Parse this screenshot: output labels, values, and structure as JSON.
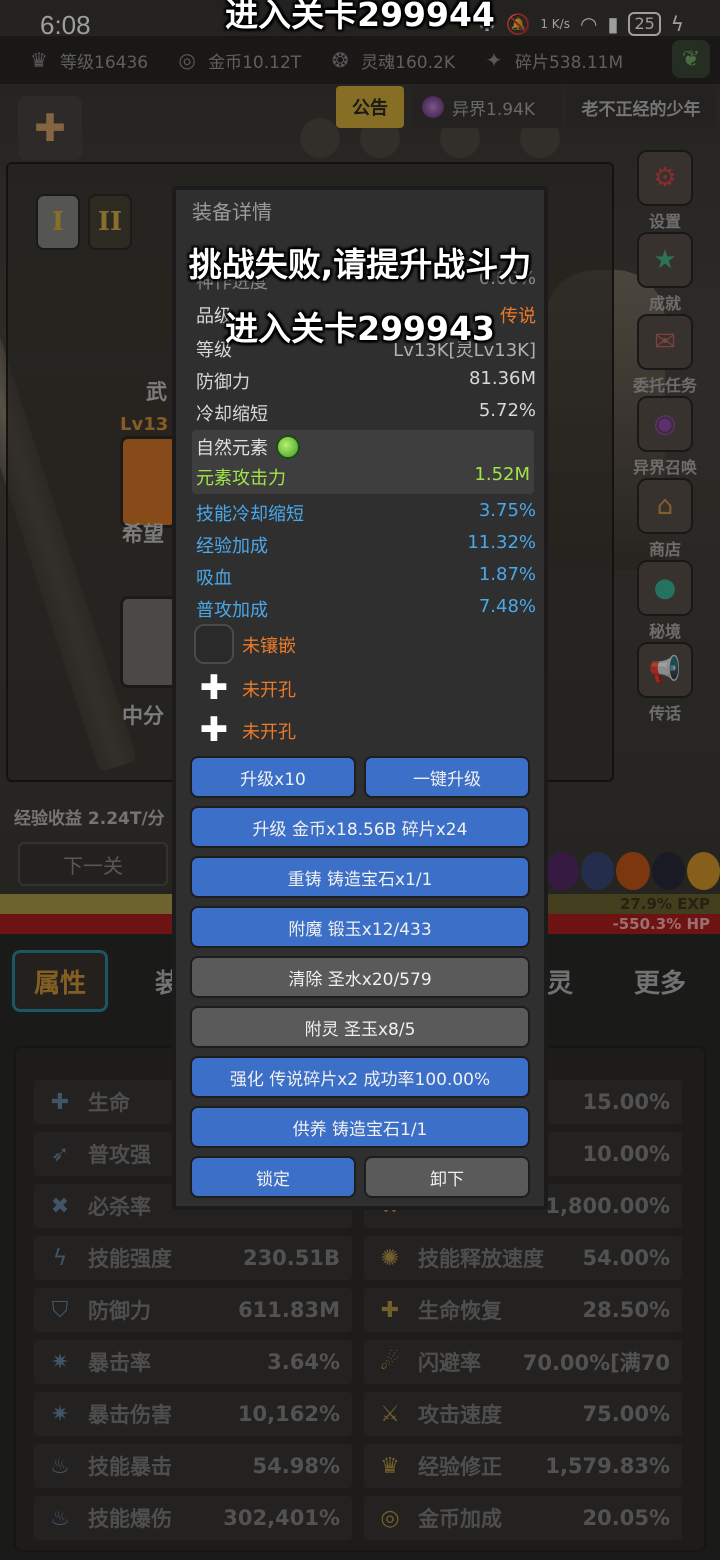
{
  "status_bar": {
    "time": "6:08",
    "speed": "1 K/s",
    "battery": "25"
  },
  "resources": {
    "level": "等级16436",
    "gold": "金币10.12T",
    "soul": "灵魂160.2K",
    "shard": "碎片538.11M"
  },
  "top_row": {
    "notice": "公告",
    "otherworld": "异界1.94K",
    "username": "老不正经的少年"
  },
  "left_panel": {
    "tab_1": "I",
    "tab_2": "II",
    "weapon_label": "武",
    "lv_badge": "Lv13",
    "item_1_name": "希望",
    "item_2_name": "中分"
  },
  "right_menu": [
    "设置",
    "成就",
    "委托任务",
    "异界召唤",
    "商店",
    "秘境",
    "传话"
  ],
  "exp_income": "经验收益 2.24T/分",
  "next_level_button": "下一关",
  "bars": {
    "exp_label": "27.9% EXP",
    "exp_fraction": 0.279,
    "hp_label": "-550.3%  HP"
  },
  "bottom_tabs": {
    "active": "属性",
    "tab_2": "装",
    "tab_3": "灵",
    "more": "更多"
  },
  "stats_left": [
    {
      "name": "生命",
      "value": ""
    },
    {
      "name": "普攻强",
      "value": ""
    },
    {
      "name": "必杀率",
      "value": ""
    },
    {
      "name": "技能强度",
      "value": "230.51B"
    },
    {
      "name": "防御力",
      "value": "611.83M"
    },
    {
      "name": "暴击率",
      "value": "3.64%"
    },
    {
      "name": "暴击伤害",
      "value": "10,162%"
    },
    {
      "name": "技能暴击",
      "value": "54.98%"
    },
    {
      "name": "技能爆伤",
      "value": "302,401%"
    }
  ],
  "stats_right": [
    {
      "name": "",
      "value": "15.00%"
    },
    {
      "name": "",
      "value": "10.00%"
    },
    {
      "name": "",
      "value": "1,800.00%"
    },
    {
      "name": "技能释放速度",
      "value": "54.00%"
    },
    {
      "name": "生命恢复",
      "value": "28.50%"
    },
    {
      "name": "闪避率",
      "value": "70.00%[满70"
    },
    {
      "name": "攻击速度",
      "value": "75.00%"
    },
    {
      "name": "经验修正",
      "value": "1,579.83%"
    },
    {
      "name": "金币加成",
      "value": "20.05%"
    }
  ],
  "modal": {
    "title": "装备详情",
    "progress_label": "神作进度",
    "progress_value": "0.00%",
    "quality_label": "品级",
    "quality_value": "传说",
    "level_label": "等级",
    "level_value": "Lv13K[灵Lv13K]",
    "defense_label": "防御力",
    "defense_value": "81.36M",
    "cooldown_label": "冷却缩短",
    "cooldown_value": "5.72%",
    "element_title": "自然元素",
    "element_attack_label": "元素攻击力",
    "element_attack_value": "1.52M",
    "blue_stats": [
      {
        "k": "技能冷却缩短",
        "v": "3.75%"
      },
      {
        "k": "经验加成",
        "v": "11.32%"
      },
      {
        "k": "吸血",
        "v": "1.87%"
      },
      {
        "k": "普攻加成",
        "v": "7.48%"
      }
    ],
    "sockets": [
      "未镶嵌",
      "未开孔",
      "未开孔"
    ],
    "buttons": {
      "upgrade_x10": "升级x10",
      "one_key_upgrade": "一键升级",
      "upgrade_cost": "升级 金币x18.56B 碎片x24",
      "reforge": "重铸 铸造宝石x1/1",
      "enchant": "附魔 锻玉x12/433",
      "clear": "清除 圣水x20/579",
      "spirit": "附灵 圣玉x8/5",
      "strengthen": "强化 传说碎片x2 成功率100.00%",
      "nurture": "供养 铸造宝石1/1",
      "lock": "锁定",
      "unequip": "卸下"
    }
  },
  "toasts": {
    "top": "进入关卡299944",
    "fail": "挑战失败,请提升战斗力",
    "enter": "进入关卡299943"
  }
}
